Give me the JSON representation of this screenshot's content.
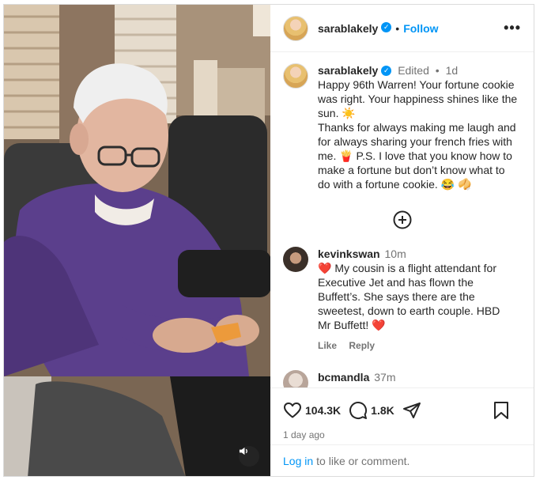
{
  "header": {
    "username": "sarablakely",
    "separator": "•",
    "follow_label": "Follow",
    "more_icon": "more-horizontal-icon"
  },
  "caption": {
    "username": "sarablakely",
    "edited": "Edited",
    "separator": "•",
    "time": "1d",
    "lines": [
      "Happy 96th Warren! Your fortune cookie",
      "was right. Your happiness shines like the",
      "sun. ☀️",
      "Thanks for always making me laugh and",
      "for always sharing your french fries with",
      "me. 🍟 P.S. I love that you know how to",
      "make a fortune but don’t know what to",
      "do with a fortune cookie. 😂 🥠"
    ]
  },
  "comments": [
    {
      "username": "kevinkswan",
      "time": "10m",
      "lines": [
        "❤️ My cousin is a flight attendant for",
        "Executive Jet and has flown the",
        "Buffett’s. She says there are the",
        "sweetest, down to earth couple. HBD",
        "Mr Buffett! ❤️"
      ],
      "like_label": "Like",
      "reply_label": "Reply"
    },
    {
      "username": "bcmandla",
      "time": "37m"
    }
  ],
  "actions": {
    "likes": "104.3K",
    "comments": "1.8K",
    "time_ago": "1 day ago"
  },
  "login": {
    "link": "Log in",
    "text": "to like or comment."
  },
  "colors": {
    "link_blue": "#0095f6",
    "verified_blue": "#0095f6",
    "muted": "#737373",
    "heart_red": "#ed4956"
  }
}
